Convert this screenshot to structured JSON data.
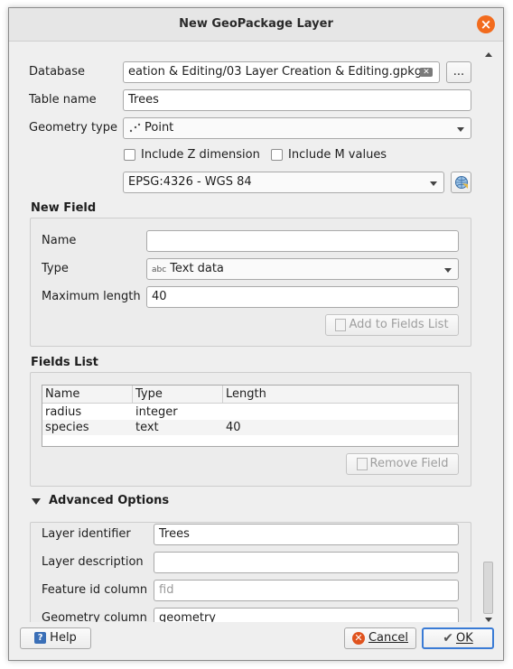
{
  "window": {
    "title": "New GeoPackage Layer"
  },
  "database": {
    "label": "Database",
    "value": "eation & Editing/03 Layer Creation & Editing.gpkg",
    "browse_label": "..."
  },
  "table_name": {
    "label": "Table name",
    "value": "Trees"
  },
  "geometry_type": {
    "label": "Geometry type",
    "value": "Point"
  },
  "include_z": {
    "label": "Include Z dimension",
    "checked": false
  },
  "include_m": {
    "label": "Include M values",
    "checked": false
  },
  "crs": {
    "value": "EPSG:4326 - WGS 84"
  },
  "new_field": {
    "title": "New Field",
    "name_label": "Name",
    "name_value": "",
    "type_label": "Type",
    "type_icon_text": "abc",
    "type_value": "Text data",
    "max_length_label": "Maximum length",
    "max_length_value": "40",
    "add_button": "Add to Fields List"
  },
  "fields_list": {
    "title": "Fields List",
    "columns": [
      "Name",
      "Type",
      "Length"
    ],
    "rows": [
      {
        "name": "radius",
        "type": "integer",
        "length": ""
      },
      {
        "name": "species",
        "type": "text",
        "length": "40"
      }
    ],
    "remove_button": "Remove Field"
  },
  "advanced": {
    "title": "Advanced Options",
    "layer_identifier_label": "Layer identifier",
    "layer_identifier_value": "Trees",
    "layer_description_label": "Layer description",
    "layer_description_value": "",
    "feature_id_label": "Feature id column",
    "feature_id_placeholder": "fid",
    "geometry_column_label": "Geometry column",
    "geometry_column_value": "geometry"
  },
  "footer": {
    "help": "Help",
    "help_icon": "?",
    "cancel": "Cancel",
    "ok": "OK"
  },
  "colors": {
    "close": "#f26b1d",
    "ok_border": "#3a7bd5"
  }
}
